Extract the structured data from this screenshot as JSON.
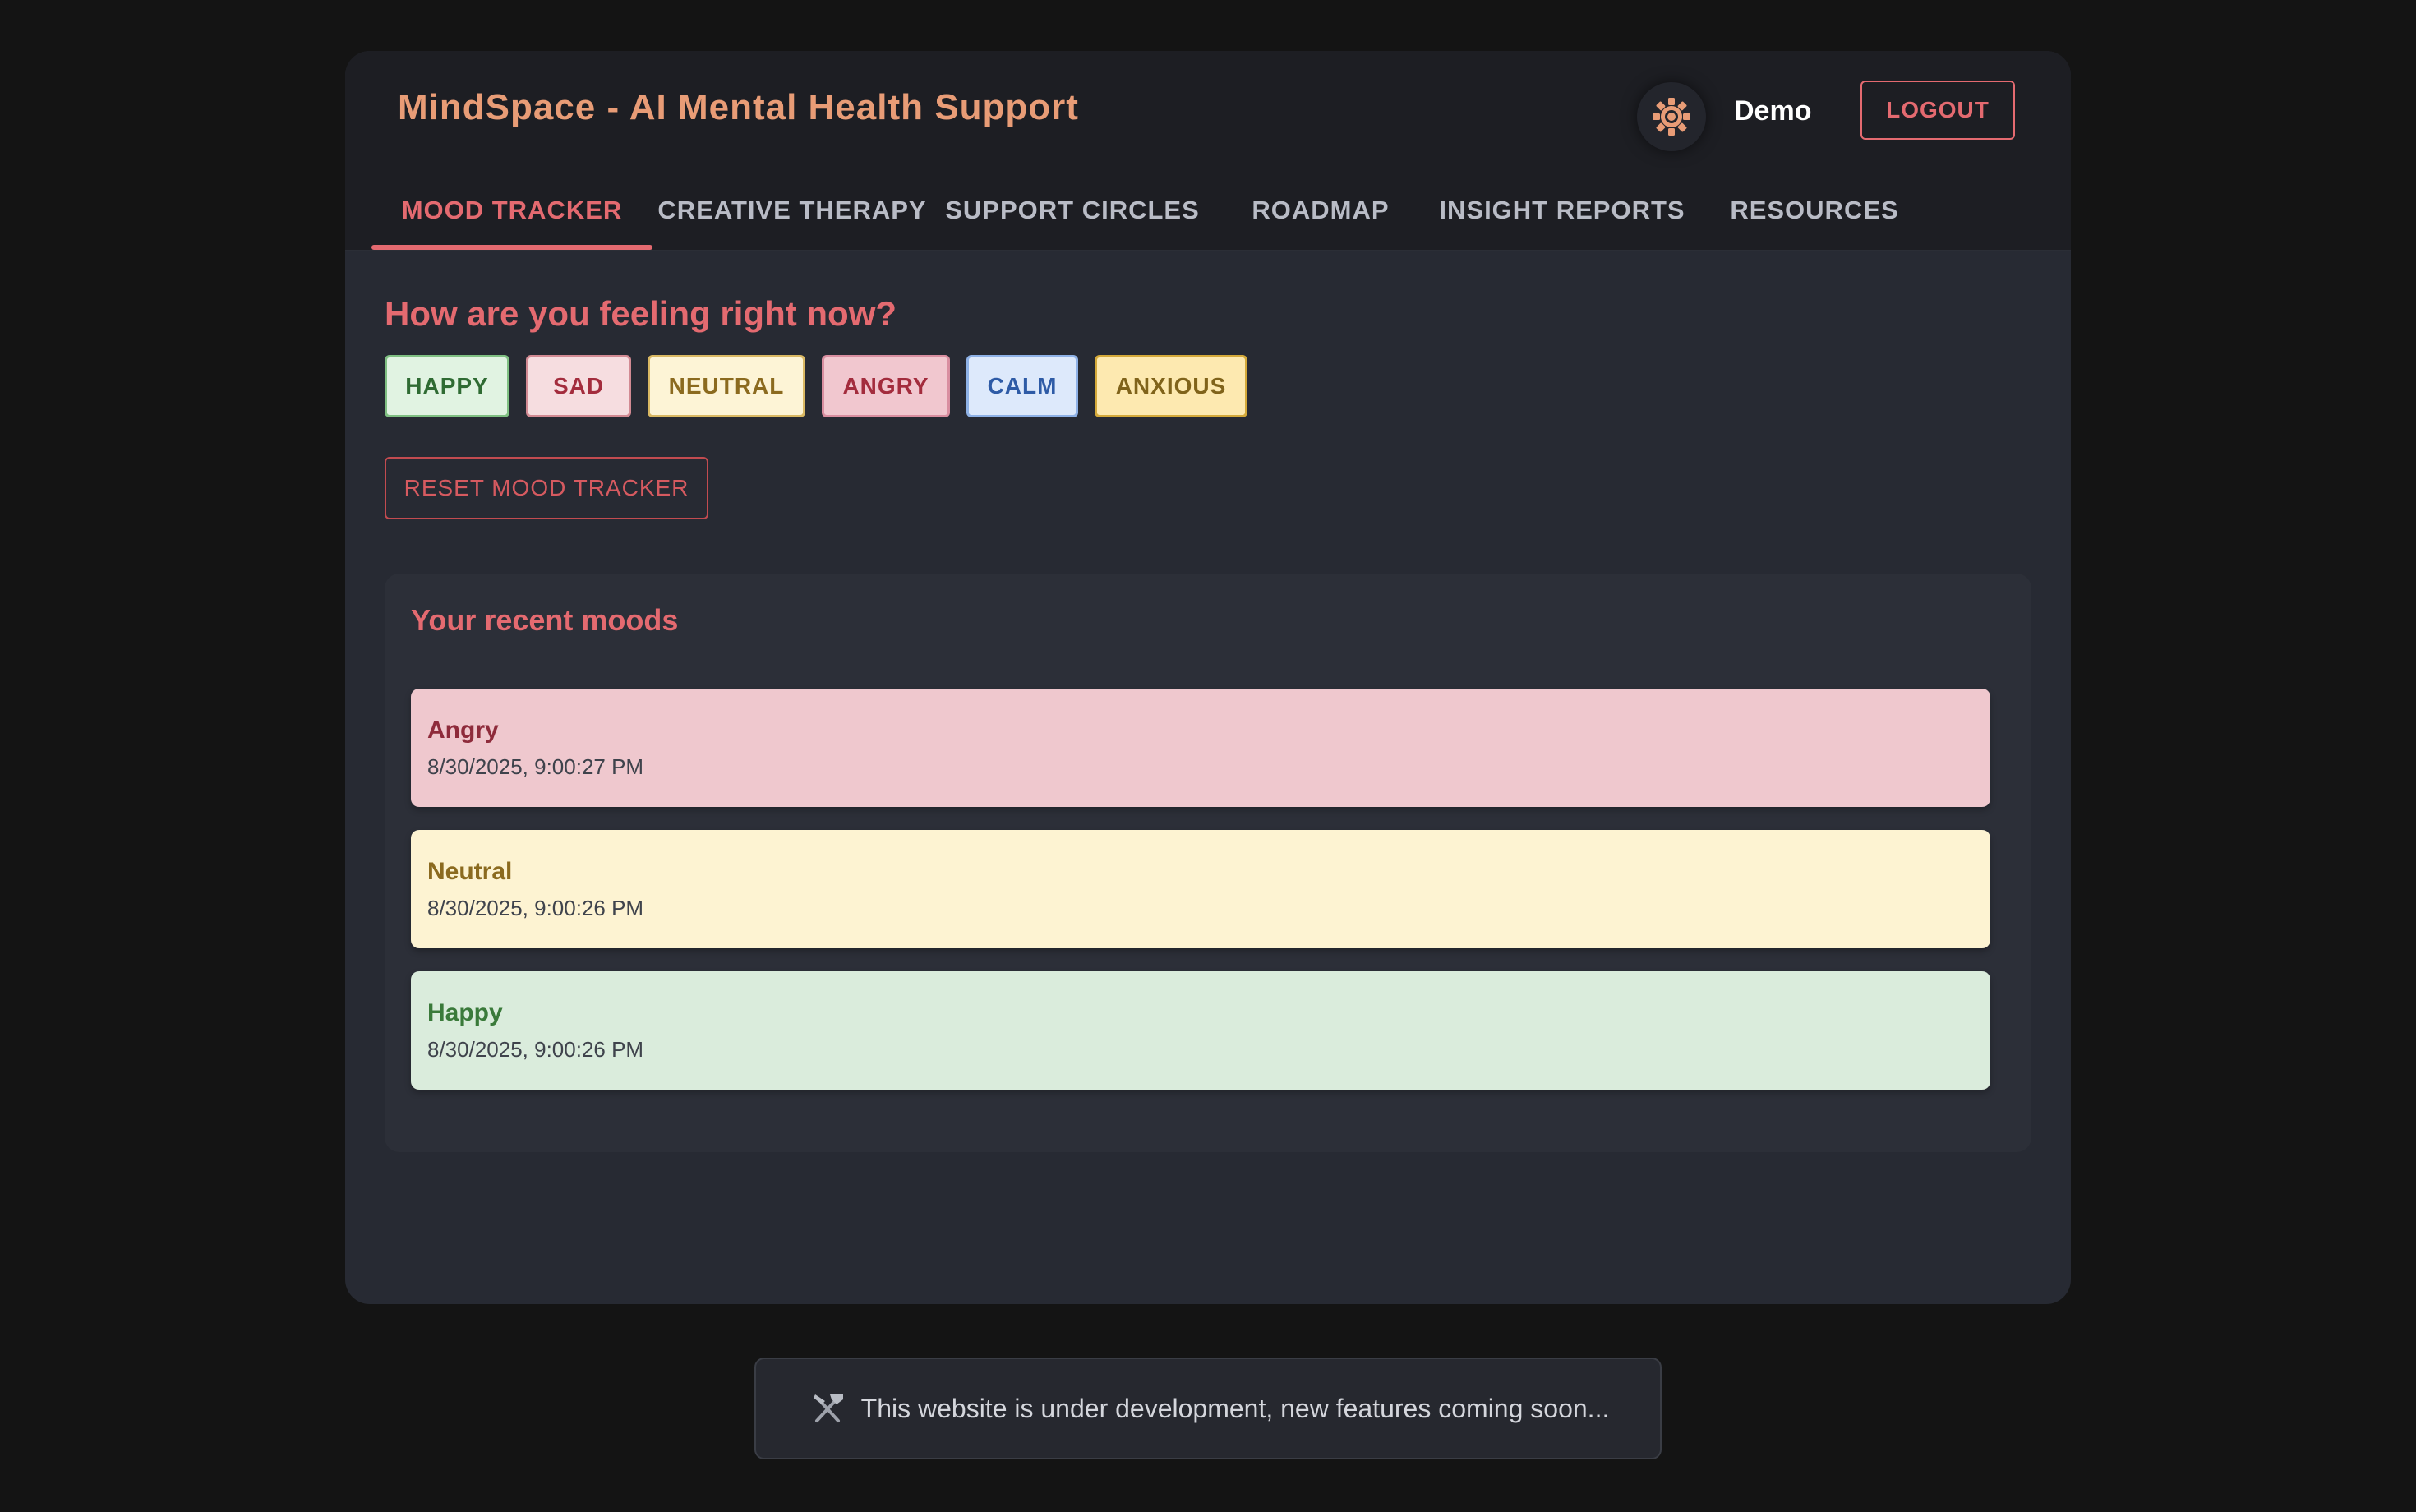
{
  "header": {
    "title": "MindSpace - AI Mental Health Support",
    "username": "Demo",
    "logout_label": "LOGOUT",
    "theme_icon": "sun-icon"
  },
  "tabs": [
    {
      "label": "MOOD TRACKER",
      "active": true
    },
    {
      "label": "CREATIVE THERAPY",
      "active": false
    },
    {
      "label": "SUPPORT CIRCLES",
      "active": false
    },
    {
      "label": "ROADMAP",
      "active": false
    },
    {
      "label": "INSIGHT REPORTS",
      "active": false
    },
    {
      "label": "RESOURCES",
      "active": false
    }
  ],
  "mood_tracker": {
    "question": "How are you feeling right now?",
    "moods": [
      {
        "label": "HAPPY",
        "bg": "#e1f3e2",
        "border": "#7fbf82",
        "color": "#2f6b33"
      },
      {
        "label": "SAD",
        "bg": "#f6dde0",
        "border": "#d28a93",
        "color": "#a32c3d"
      },
      {
        "label": "NEUTRAL",
        "bg": "#fdf4d6",
        "border": "#d9b863",
        "color": "#8b6a1f"
      },
      {
        "label": "ANGRY",
        "bg": "#f1c7cf",
        "border": "#d98ea0",
        "color": "#a32c3d"
      },
      {
        "label": "CALM",
        "bg": "#dde9fb",
        "border": "#8eb1e6",
        "color": "#2e5ba6"
      },
      {
        "label": "ANXIOUS",
        "bg": "#fde9b0",
        "border": "#d4a93a",
        "color": "#80631a"
      }
    ],
    "reset_label": "RESET MOOD TRACKER"
  },
  "recent": {
    "title": "Your recent moods",
    "entries": [
      {
        "mood": "Angry",
        "time": "8/30/2025, 9:00:27 PM",
        "bg": "#efc8ce",
        "color": "#8e2b3b"
      },
      {
        "mood": "Neutral",
        "time": "8/30/2025, 9:00:26 PM",
        "bg": "#fdf3d2",
        "color": "#8b6a1f"
      },
      {
        "mood": "Happy",
        "time": "8/30/2025, 9:00:26 PM",
        "bg": "#daecdc",
        "color": "#3a7a3a"
      }
    ]
  },
  "banner": {
    "icon": "tools-icon",
    "text": "This website is under development, new features coming soon..."
  }
}
